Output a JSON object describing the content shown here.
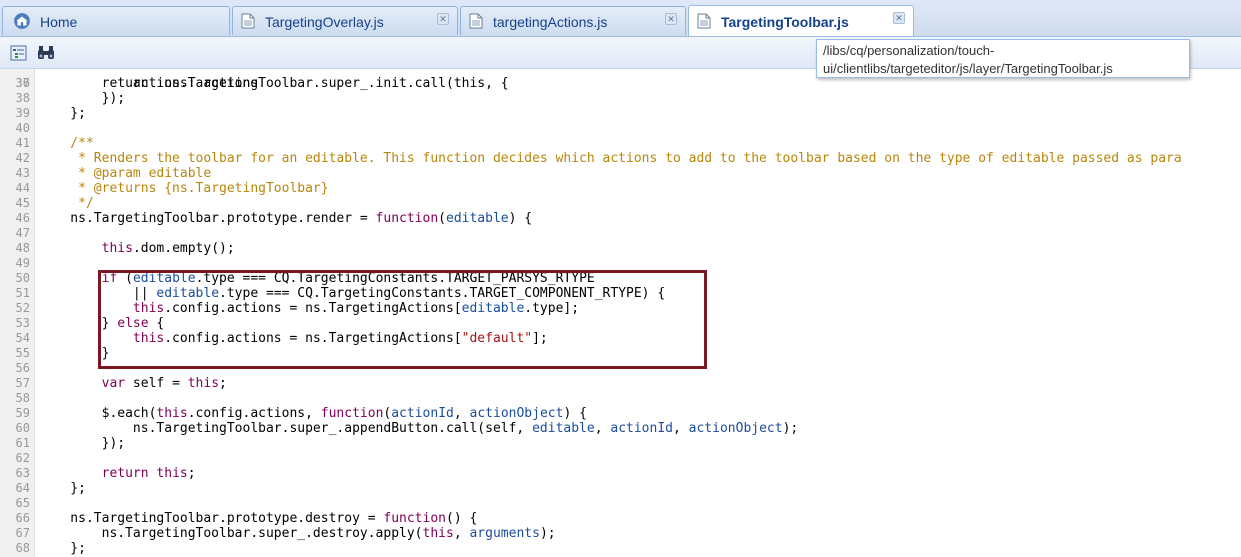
{
  "tabs": [
    {
      "label": "Home",
      "icon": "home-icon",
      "closable": false,
      "active": false
    },
    {
      "label": "TargetingOverlay.js",
      "icon": "file-icon",
      "closable": true,
      "active": false
    },
    {
      "label": "targetingActions.js",
      "icon": "file-icon",
      "closable": true,
      "active": false
    },
    {
      "label": "TargetingToolbar.js",
      "icon": "file-icon",
      "closable": true,
      "active": true
    }
  ],
  "toolbar": {
    "buttons": [
      {
        "icon": "outline-icon"
      },
      {
        "icon": "binoculars-icon"
      }
    ]
  },
  "tooltip": {
    "line1": "/libs/cq/personalization/touch-",
    "line2": "ui/clientlibs/targeteditor/js/layer/TargetingToolbar.js"
  },
  "editor": {
    "lines": [
      {
        "n": "37",
        "t": "            actions: actions"
      },
      {
        "n": "38",
        "t": "        });"
      },
      {
        "n": "39",
        "t": "    };"
      },
      {
        "n": "40",
        "t": ""
      },
      {
        "n": "41",
        "t": "    /**"
      },
      {
        "n": "42",
        "t": "     * Renders the toolbar for an editable. This function decides which actions to add to the toolbar based on the type of editable passed as para"
      },
      {
        "n": "43",
        "t": "     * @param editable"
      },
      {
        "n": "44",
        "t": "     * @returns {ns.TargetingToolbar}"
      },
      {
        "n": "45",
        "t": "     */"
      },
      {
        "n": "46",
        "t": "    ns.TargetingToolbar.prototype.render = function(editable) {"
      },
      {
        "n": "47",
        "t": ""
      },
      {
        "n": "48",
        "t": "        this.dom.empty();"
      },
      {
        "n": "49",
        "t": ""
      },
      {
        "n": "50",
        "t": "        if (editable.type === CQ.TargetingConstants.TARGET_PARSYS_RTYPE"
      },
      {
        "n": "51",
        "t": "            || editable.type === CQ.TargetingConstants.TARGET_COMPONENT_RTYPE) {"
      },
      {
        "n": "52",
        "t": "            this.config.actions = ns.TargetingActions[editable.type];"
      },
      {
        "n": "53",
        "t": "        } else {"
      },
      {
        "n": "54",
        "t": "            this.config.actions = ns.TargetingActions[\"default\"];"
      },
      {
        "n": "55",
        "t": "        }"
      },
      {
        "n": "56",
        "t": ""
      },
      {
        "n": "57",
        "t": "        var self = this;"
      },
      {
        "n": "58",
        "t": ""
      },
      {
        "n": "59",
        "t": "        $.each(this.config.actions, function(actionId, actionObject) {"
      },
      {
        "n": "60",
        "t": "            ns.TargetingToolbar.super_.appendButton.call(self, editable, actionId, actionObject);"
      },
      {
        "n": "61",
        "t": "        });"
      },
      {
        "n": "62",
        "t": ""
      },
      {
        "n": "63",
        "t": "        return this;"
      },
      {
        "n": "64",
        "t": "    };"
      },
      {
        "n": "65",
        "t": ""
      },
      {
        "n": "66",
        "t": "    ns.TargetingToolbar.prototype.destroy = function() {"
      },
      {
        "n": "67",
        "t": "        ns.TargetingToolbar.super_.destroy.apply(this, arguments);"
      },
      {
        "n": "68",
        "t": "    };"
      }
    ],
    "highlighted_range": [
      "50",
      "55"
    ]
  },
  "colors": {
    "highlight_border": "#7b1722",
    "tab_text": "#15428b"
  }
}
